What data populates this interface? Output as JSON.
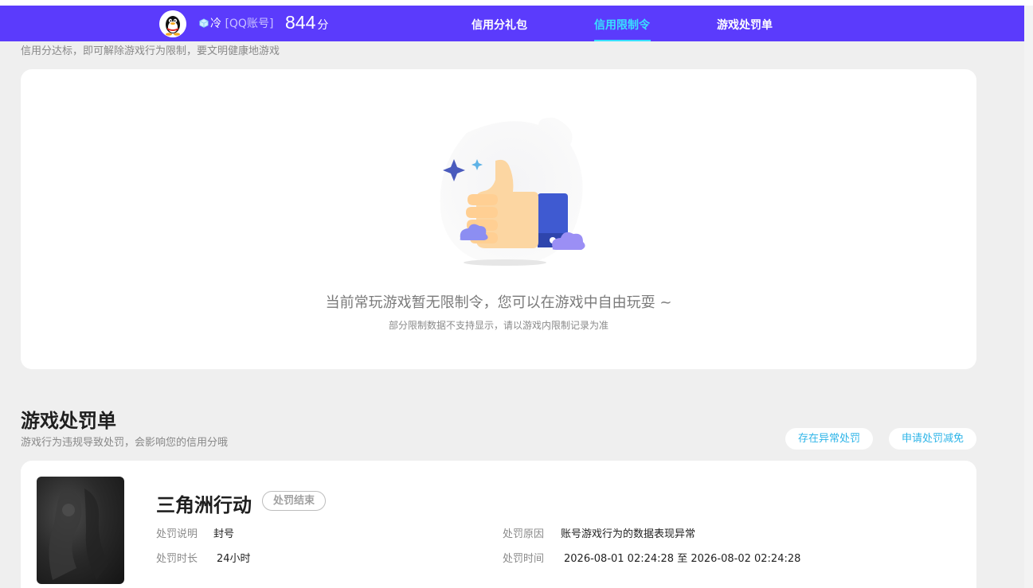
{
  "header": {
    "user_name": "冷",
    "account_type": "[QQ账号]",
    "score": "844",
    "score_unit": "分",
    "tabs": [
      {
        "label": "信用分礼包",
        "active": false
      },
      {
        "label": "信用限制令",
        "active": true
      },
      {
        "label": "游戏处罚单",
        "active": false
      }
    ],
    "colors": {
      "bar": "#5b3bfc",
      "active_tab": "#39e0ff"
    }
  },
  "restriction": {
    "hint": "信用分达标，即可解除游戏行为限制，要文明健康地游戏",
    "empty_title": "当前常玩游戏暂无限制令，您可以在游戏中自由玩耍 ~",
    "empty_sub": "部分限制数据不支持显示，请以游戏内限制记录为准",
    "illustration": "thumbs-up-icon"
  },
  "penalty": {
    "title": "游戏处罚单",
    "subtitle": "游戏行为违规导致处罚，会影响您的信用分哦",
    "buttons": {
      "abnormal": "存在异常处罚",
      "reduce": "申请处罚减免"
    },
    "items": [
      {
        "game": "三角洲行动",
        "status": "处罚结束",
        "desc_label": "处罚说明",
        "desc_value": "封号",
        "duration_label": "处罚时长",
        "duration_value": "24小时",
        "reason_label": "处罚原因",
        "reason_value": "账号游戏行为的数据表现异常",
        "time_label": "处罚时间",
        "time_value": "2026-08-01 02:24:28 至 2026-08-02 02:24:28"
      }
    ]
  }
}
